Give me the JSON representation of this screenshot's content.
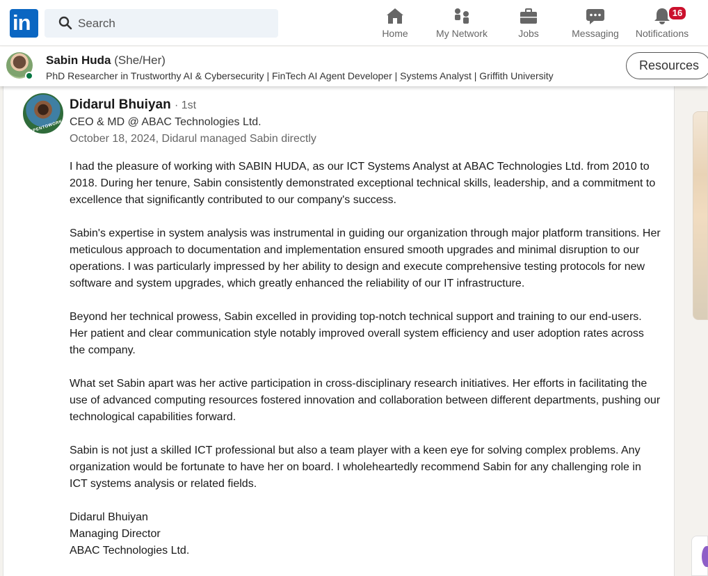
{
  "nav": {
    "search_placeholder": "Search",
    "items": [
      {
        "label": "Home",
        "icon": "home-icon"
      },
      {
        "label": "My Network",
        "icon": "network-icon"
      },
      {
        "label": "Jobs",
        "icon": "briefcase-icon"
      },
      {
        "label": "Messaging",
        "icon": "message-icon"
      },
      {
        "label": "Notifications",
        "icon": "bell-icon"
      }
    ],
    "notification_count": "16"
  },
  "profile": {
    "name": "Sabin Huda",
    "pronouns": "(She/Her)",
    "headline": "PhD Researcher in Trustworthy AI & Cybersecurity | FinTech AI Agent Developer | Systems Analyst | Griffith University",
    "resources_label": "Resources"
  },
  "recommendation": {
    "name": "Didarul Bhuiyan",
    "degree": "· 1st",
    "title": "CEO & MD @ ABAC Technologies Ltd.",
    "date": "October 18, 2024, Didarul managed Sabin directly",
    "paragraphs": [
      "I had the pleasure of working with SABIN HUDA, as our ICT Systems Analyst at ABAC Technologies Ltd. from 2010 to 2018. During her tenure, Sabin consistently demonstrated exceptional technical skills, leadership, and a commitment to excellence that significantly contributed to our company's success.",
      "Sabin's expertise in system analysis was instrumental in guiding our organization through major platform transitions. Her meticulous approach to documentation and implementation ensured smooth upgrades and minimal disruption to our operations. I was particularly impressed by her ability to design and execute comprehensive testing protocols for new software and system upgrades, which greatly enhanced the reliability of our IT infrastructure.",
      "Beyond her technical prowess, Sabin excelled in providing top-notch technical support and training to our end-users. Her patient and clear communication style notably improved overall system efficiency and user adoption rates across the company.",
      "What set Sabin apart was her active participation in cross-disciplinary research initiatives. Her efforts in facilitating the use of advanced computing resources fostered innovation and collaboration between different departments, pushing our technological capabilities forward.",
      "Sabin is not just a skilled ICT professional but also a team player with a keen eye for solving complex problems. Any organization would be fortunate to have her on board. I wholeheartedly recommend Sabin for any challenging role in ICT systems analysis or related fields."
    ],
    "signature": [
      "Didarul Bhuiyan",
      "Managing Director",
      "ABAC Technologies Ltd."
    ],
    "avatar_badge": "#OPENTOWORK"
  },
  "colors": {
    "brand": "#0a66c2",
    "badge": "#cb112d",
    "online": "#057642"
  }
}
